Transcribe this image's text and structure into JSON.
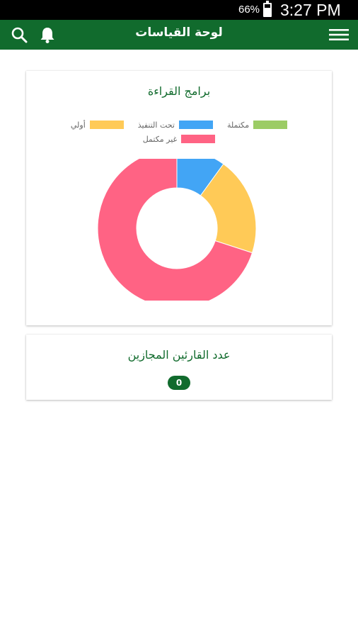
{
  "status_bar": {
    "battery": "66%",
    "time": "3:27 PM"
  },
  "app_bar": {
    "title": "لوحة القياسات",
    "icons": {
      "search": "search-icon",
      "notifications": "bell-icon",
      "menu": "hamburger-menu-icon"
    },
    "color": "#116b2d"
  },
  "programs_card": {
    "title": "برامج القراءة",
    "legend": [
      {
        "label": "مكتملة",
        "color": "#9ccc65"
      },
      {
        "label": "تحت التنفيذ",
        "color": "#42a5f5"
      },
      {
        "label": "أولي",
        "color": "#ffca57"
      },
      {
        "label": "غير مكتمل",
        "color": "#ff6384"
      }
    ]
  },
  "readers_card": {
    "title": "عدد القارئين المجازين",
    "count": "0"
  },
  "chart_data": {
    "type": "pie",
    "donut": true,
    "categories": [
      "مكتملة",
      "تحت التنفيذ",
      "أولي",
      "غير مكتمل"
    ],
    "values": [
      0,
      10,
      20,
      70
    ],
    "colors": [
      "#9ccc65",
      "#42a5f5",
      "#ffca57",
      "#ff6384"
    ]
  }
}
